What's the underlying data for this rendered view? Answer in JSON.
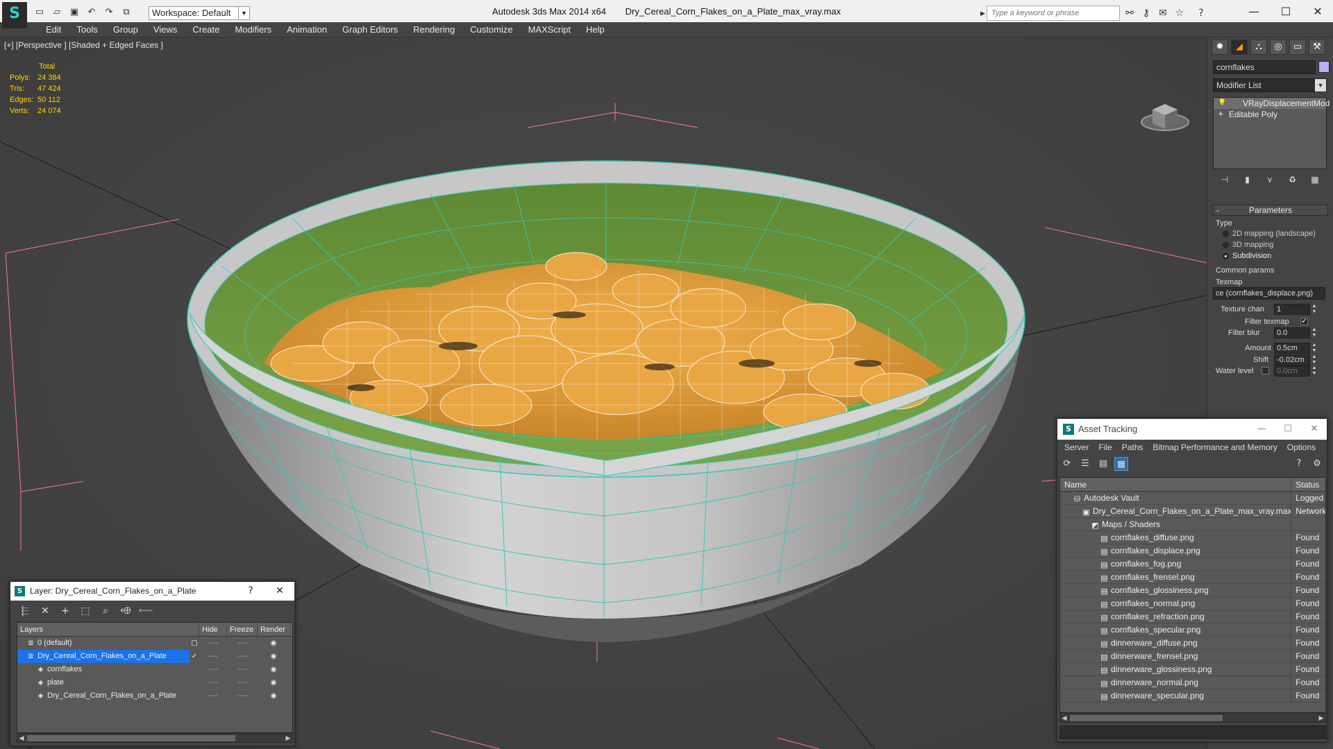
{
  "app": {
    "title": "Autodesk 3ds Max  2014 x64",
    "file": "Dry_Cereal_Corn_Flakes_on_a_Plate_max_vray.max",
    "logo_glyph": "S",
    "workspace": "Workspace: Default",
    "search_placeholder": "Type a keyword or phrase"
  },
  "menu": [
    "Edit",
    "Tools",
    "Group",
    "Views",
    "Create",
    "Modifiers",
    "Animation",
    "Graph Editors",
    "Rendering",
    "Customize",
    "MAXScript",
    "Help"
  ],
  "viewport": {
    "label": "[+] [Perspective ] [Shaded + Edged Faces ]",
    "stats": {
      "header": "Total",
      "rows": [
        {
          "k": "Polys:",
          "v": "24 384"
        },
        {
          "k": "Tris:",
          "v": "47 424"
        },
        {
          "k": "Edges:",
          "v": "50 112"
        },
        {
          "k": "Verts:",
          "v": "24 074"
        }
      ]
    },
    "colors": {
      "bg": "#434343",
      "bowl_inner": "#6f9a3c",
      "bowl_outer": "#bfbfbf",
      "wire": "#35c9b8",
      "flake": "#e7a640",
      "grid_pink": "#ff5fb0"
    }
  },
  "command_panel": {
    "object_name": "cornflakes",
    "modifier_list": "Modifier List",
    "stack": [
      "VRayDisplacementMod",
      "Editable Poly"
    ],
    "parameters": {
      "header": "Parameters",
      "type_label": "Type",
      "type_options": [
        "2D mapping (landscape)",
        "3D mapping",
        "Subdivision"
      ],
      "selected_type": "Subdivision",
      "common_label": "Common params",
      "texmap_label": "Texmap",
      "texmap_value": "ce (cornflakes_displace.png)",
      "texture_chan_label": "Texture chan",
      "texture_chan_value": "1",
      "filter_texmap_label": "Filter texmap",
      "filter_blur_label": "Filter blur",
      "filter_blur_value": "0.0",
      "amount_label": "Amount",
      "amount_value": "0.5cm",
      "shift_label": "Shift",
      "shift_value": "-0.02cm",
      "water_level_label": "Water level",
      "water_level_value": "0.0cm"
    }
  },
  "asset_tracking": {
    "title": "Asset Tracking",
    "menu": [
      "Server",
      "File",
      "Paths",
      "Bitmap Performance and Memory",
      "Options"
    ],
    "columns": [
      "Name",
      "Status"
    ],
    "rows": [
      {
        "name": "Autodesk Vault",
        "status": "Logged",
        "indent": 1,
        "icon": "vault-icon"
      },
      {
        "name": "Dry_Cereal_Corn_Flakes_on_a_Plate_max_vray.max",
        "status": "Network",
        "indent": 2,
        "icon": "max-file-icon"
      },
      {
        "name": "Maps / Shaders",
        "status": "",
        "indent": 3,
        "icon": "maps-folder-icon"
      },
      {
        "name": "cornflakes_diffuse.png",
        "status": "Found",
        "indent": 4,
        "icon": "image-file-icon"
      },
      {
        "name": "cornflakes_displace.png",
        "status": "Found",
        "indent": 4,
        "icon": "image-file-icon"
      },
      {
        "name": "cornflakes_fog.png",
        "status": "Found",
        "indent": 4,
        "icon": "image-file-icon"
      },
      {
        "name": "cornflakes_frensel.png",
        "status": "Found",
        "indent": 4,
        "icon": "image-file-icon"
      },
      {
        "name": "cornflakes_glossiness.png",
        "status": "Found",
        "indent": 4,
        "icon": "image-file-icon"
      },
      {
        "name": "cornflakes_normal.png",
        "status": "Found",
        "indent": 4,
        "icon": "image-file-icon"
      },
      {
        "name": "cornflakes_refraction.png",
        "status": "Found",
        "indent": 4,
        "icon": "image-file-icon"
      },
      {
        "name": "cornflakes_specular.png",
        "status": "Found",
        "indent": 4,
        "icon": "image-file-icon"
      },
      {
        "name": "dinnerware_diffuse.png",
        "status": "Found",
        "indent": 4,
        "icon": "image-file-icon"
      },
      {
        "name": "dinnerware_frensel.png",
        "status": "Found",
        "indent": 4,
        "icon": "image-file-icon"
      },
      {
        "name": "dinnerware_glossiness.png",
        "status": "Found",
        "indent": 4,
        "icon": "image-file-icon"
      },
      {
        "name": "dinnerware_normal.png",
        "status": "Found",
        "indent": 4,
        "icon": "image-file-icon"
      },
      {
        "name": "dinnerware_specular.png",
        "status": "Found",
        "indent": 4,
        "icon": "image-file-icon"
      }
    ]
  },
  "layer_dialog": {
    "title": "Layer: Dry_Cereal_Corn_Flakes_on_a_Plate",
    "help": "?",
    "columns": [
      "Layers",
      "Hide",
      "Freeze",
      "Render"
    ],
    "rows": [
      {
        "name": "0 (default)",
        "indent": 1,
        "selected": false,
        "icon": "layer-icon",
        "hide": "----",
        "freeze": "----"
      },
      {
        "name": "Dry_Cereal_Corn_Flakes_on_a_Plate",
        "indent": 1,
        "selected": true,
        "icon": "layer-icon",
        "hide": "----",
        "freeze": "----"
      },
      {
        "name": "cornflakes",
        "indent": 2,
        "selected": false,
        "icon": "object-icon",
        "hide": "----",
        "freeze": "----"
      },
      {
        "name": "plate",
        "indent": 2,
        "selected": false,
        "icon": "object-icon",
        "hide": "----",
        "freeze": "----"
      },
      {
        "name": "Dry_Cereal_Corn_Flakes_on_a_Plate",
        "indent": 2,
        "selected": false,
        "icon": "object-icon",
        "hide": "----",
        "freeze": "----"
      }
    ]
  }
}
